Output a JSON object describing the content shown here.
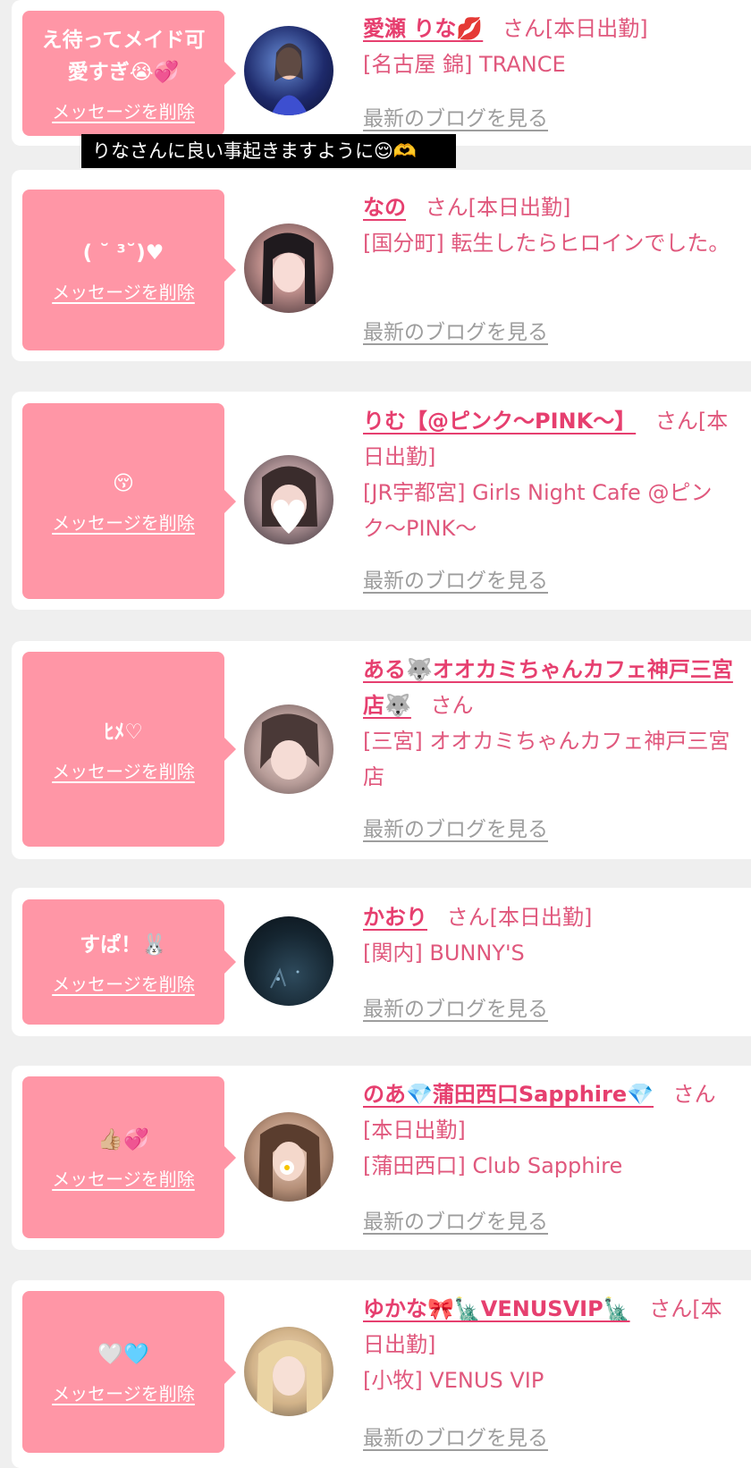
{
  "toast": "りなさんに良い事起きますように😌🫶",
  "entries": [
    {
      "message": "え待ってメイド可愛すぎ😭💞",
      "delete_label": "メッセージを削除",
      "name": "愛瀬 りな💋",
      "san": "さん",
      "status": "[本日出勤]",
      "shop": "[名古屋 錦] TRANCE",
      "blog": "最新のブログを見る"
    },
    {
      "message": "( ˘ ³˘)♥",
      "delete_label": "メッセージを削除",
      "name": "なの",
      "san": "さん",
      "status": "[本日出勤]",
      "shop": "[国分町] 転生したらヒロインでした。",
      "blog": "最新のブログを見る"
    },
    {
      "message": "😚",
      "delete_label": "メッセージを削除",
      "name": "りむ【@ピンク〜PINK〜】",
      "san": "さん",
      "status": "[本日出勤]",
      "shop": "[JR宇都宮] Girls Night Cafe @ピンク〜PINK〜",
      "blog": "最新のブログを見る"
    },
    {
      "message": "ﾋﾒ♡",
      "delete_label": "メッセージを削除",
      "name": "ある🐺オオカミちゃんカフェ神戸三宮店🐺",
      "san": "さん",
      "status": "",
      "shop": "[三宮] オオカミちゃんカフェ神戸三宮店",
      "blog": "最新のブログを見る"
    },
    {
      "message": "すぱ！🐰",
      "delete_label": "メッセージを削除",
      "name": "かおり",
      "san": "さん",
      "status": "[本日出勤]",
      "shop": "[関内] BUNNY'S",
      "blog": "最新のブログを見る"
    },
    {
      "message": "👍🏼💞",
      "delete_label": "メッセージを削除",
      "name": "のあ💎蒲田西口Sapphire💎",
      "san": "さん",
      "status": "[本日出勤]",
      "shop": "[蒲田西口] Club Sapphire",
      "blog": "最新のブログを見る"
    },
    {
      "message": "🤍🩵",
      "delete_label": "メッセージを削除",
      "name": "ゆかな🎀🗽VENUSVIP🗽",
      "san": "さん",
      "status": "[本日出勤]",
      "shop": "[小牧] VENUS VIP",
      "blog": "最新のブログを見る"
    }
  ],
  "colors": {
    "bubble": "#ff96a6",
    "name": "#e63f6f",
    "text": "#e0587d",
    "blog": "#9d9d9d",
    "background": "#efefef"
  }
}
